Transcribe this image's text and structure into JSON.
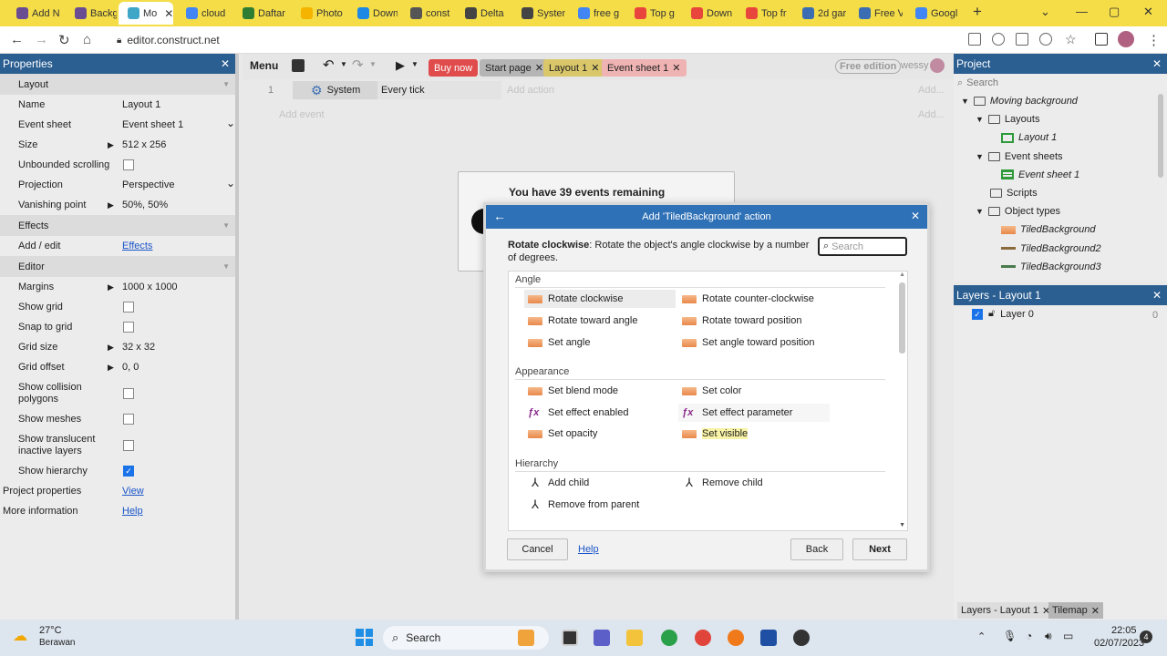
{
  "browser": {
    "tabs": [
      {
        "label": "Add N",
        "color": "#6a4c93"
      },
      {
        "label": "Backg",
        "color": "#6a4c93"
      },
      {
        "label": "Mo",
        "color": "#3fa6c8",
        "active": true
      },
      {
        "label": "cloud",
        "color": "#4285f4"
      },
      {
        "label": "Daftar",
        "color": "#2e7d32"
      },
      {
        "label": "Photo",
        "color": "#f4b400"
      },
      {
        "label": "Down",
        "color": "#1e88e5"
      },
      {
        "label": "const",
        "color": "#555555"
      },
      {
        "label": "Delta",
        "color": "#444444"
      },
      {
        "label": "Systen",
        "color": "#444444"
      },
      {
        "label": "free g",
        "color": "#4285f4"
      },
      {
        "label": "Top g",
        "color": "#e8453c"
      },
      {
        "label": "Down",
        "color": "#e8453c"
      },
      {
        "label": "Top fr",
        "color": "#e8453c"
      },
      {
        "label": "2d gar",
        "color": "#3b6db3"
      },
      {
        "label": "Free V",
        "color": "#3b6db3"
      },
      {
        "label": "Googl",
        "color": "#4285f4"
      }
    ],
    "new_tab": "+",
    "url": "editor.construct.net"
  },
  "properties": {
    "title": "Properties",
    "sections": [
      {
        "header": "Layout"
      },
      {
        "key": "Name",
        "value": "Layout 1"
      },
      {
        "key": "Event sheet",
        "value": "Event sheet 1"
      },
      {
        "key": "Size",
        "value": "512 x 256"
      },
      {
        "key": "Unbounded scrolling",
        "check": false
      },
      {
        "key": "Projection",
        "value": "Perspective"
      },
      {
        "key": "Vanishing point",
        "value": "50%, 50%"
      },
      {
        "header": "Effects"
      },
      {
        "key": "Add / edit",
        "link": "Effects"
      },
      {
        "header": "Editor"
      },
      {
        "key": "Margins",
        "value": "1000 x 1000"
      },
      {
        "key": "Show grid",
        "check": false
      },
      {
        "key": "Snap to grid",
        "check": false
      },
      {
        "key": "Grid size",
        "value": "32 x 32"
      },
      {
        "key": "Grid offset",
        "value": "0, 0"
      },
      {
        "key": "Show collision polygons",
        "check": false
      },
      {
        "key": "Show meshes",
        "check": false
      },
      {
        "key": "Show translucent inactive layers",
        "check": false
      },
      {
        "key": "Show hierarchy",
        "check": true
      },
      {
        "key": "Project properties",
        "link": "View"
      },
      {
        "key": "More information",
        "link": "Help"
      }
    ]
  },
  "toolbar": {
    "menu": "Menu",
    "tabs": [
      "Buy now",
      "Start page",
      "Layout 1",
      "Event sheet 1"
    ],
    "edition": "Free edition",
    "user": "wessy"
  },
  "sheet": {
    "row_num": "1",
    "object": "System",
    "condition": "Every tick",
    "add_action": "Add action",
    "add_event": "Add event",
    "events_remaining": "You have 39 events remaining",
    "ellipsis": "Add..."
  },
  "project": {
    "title": "Project",
    "search": "Search",
    "tree": [
      {
        "label": "Moving background",
        "italic": true
      },
      {
        "label": "Layouts"
      },
      {
        "label": "Layout 1",
        "italic": true
      },
      {
        "label": "Event sheets"
      },
      {
        "label": "Event sheet 1",
        "italic": true
      },
      {
        "label": "Scripts"
      },
      {
        "label": "Object types"
      },
      {
        "label": "TiledBackground",
        "italic": true
      },
      {
        "label": "TiledBackground2",
        "italic": true
      },
      {
        "label": "TiledBackground3",
        "italic": true
      }
    ]
  },
  "layers": {
    "title": "Layers - Layout 1",
    "layer": "Layer 0",
    "count": "0",
    "bottom_tabs": [
      "Layers - Layout 1",
      "Tilemap"
    ]
  },
  "dialog": {
    "title": "Add 'TiledBackground' action",
    "desc_bold": "Rotate clockwise",
    "desc": ": Rotate the object's angle clockwise by a number of degrees.",
    "search_placeholder": "Search",
    "groups": [
      {
        "name": "Angle",
        "items": [
          "Rotate clockwise",
          "Rotate counter-clockwise",
          "Rotate toward angle",
          "Rotate toward position",
          "Set angle",
          "Set angle toward position"
        ]
      },
      {
        "name": "Appearance",
        "items": [
          "Set blend mode",
          "Set color",
          "Set effect enabled",
          "Set effect parameter",
          "Set opacity",
          "Set visible"
        ]
      },
      {
        "name": "Hierarchy",
        "items": [
          "Add child",
          "Remove child",
          "Remove from parent"
        ]
      }
    ],
    "cancel": "Cancel",
    "help": "Help",
    "back": "Back",
    "next": "Next"
  },
  "taskbar": {
    "temp": "27°C",
    "weather": "Berawan",
    "search": "Search",
    "time": "22:05",
    "date": "02/07/2023",
    "badge": "4"
  }
}
